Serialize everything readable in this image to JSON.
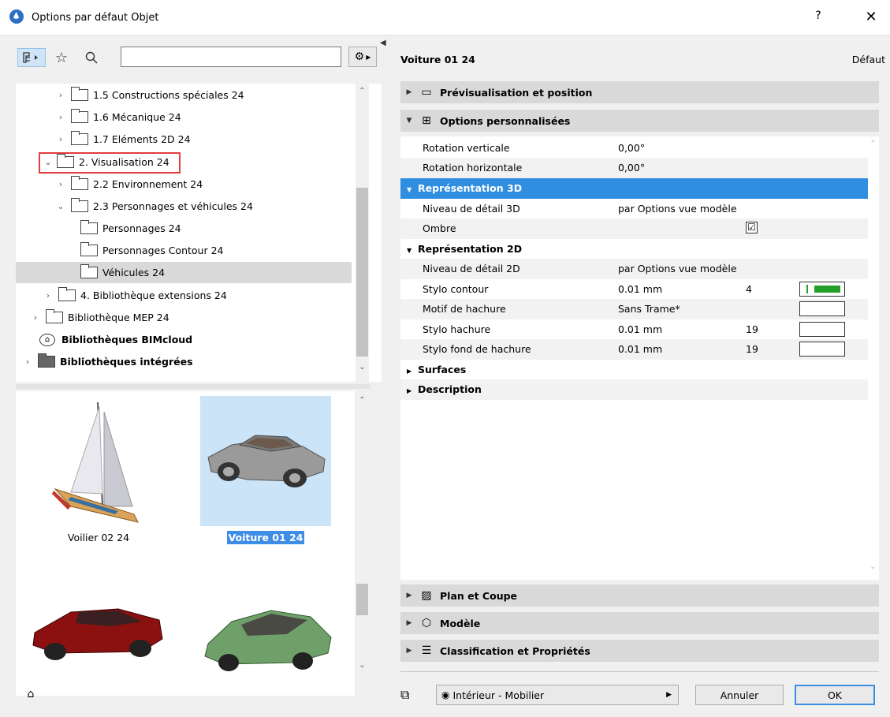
{
  "window": {
    "title": "Options par défaut Objet",
    "help": "?",
    "close": "✕"
  },
  "toolbar": {
    "search_placeholder": "",
    "search_value": ""
  },
  "tree": {
    "items": [
      {
        "label": "1.5 Constructions spéciales 24"
      },
      {
        "label": "1.6 Mécanique 24"
      },
      {
        "label": "1.7 Eléments 2D 24"
      },
      {
        "label": "2. Visualisation 24"
      },
      {
        "label": "2.2 Environnement 24"
      },
      {
        "label": "2.3 Personnages et véhicules 24"
      },
      {
        "label": "Personnages 24"
      },
      {
        "label": "Personnages Contour 24"
      },
      {
        "label": "Véhicules 24"
      },
      {
        "label": "4. Bibliothèque extensions 24"
      },
      {
        "label": "Bibliothèque MEP 24"
      },
      {
        "label": "Bibliothèques BIMcloud"
      },
      {
        "label": "Bibliothèques intégrées"
      }
    ]
  },
  "previews": [
    {
      "label": "Voilier 02 24"
    },
    {
      "label": "Voiture 01 24"
    },
    {
      "label": ""
    },
    {
      "label": ""
    }
  ],
  "object": {
    "name": "Voiture 01 24",
    "default_label": "Défaut"
  },
  "sections": {
    "preview_position": "Prévisualisation et position",
    "custom_options": "Options personnalisées",
    "plan_section": "Plan et Coupe",
    "model": "Modèle",
    "classification": "Classification et Propriétés"
  },
  "params": {
    "rot_v": {
      "name": "Rotation verticale",
      "value": "0,00°"
    },
    "rot_h": {
      "name": "Rotation horizontale",
      "value": "0,00°"
    },
    "rep3d": "Représentation 3D",
    "detail3d": {
      "name": "Niveau de détail 3D",
      "value": "par Options vue modèle"
    },
    "shadow": {
      "name": "Ombre",
      "checked": "☑"
    },
    "rep2d": "Représentation 2D",
    "detail2d": {
      "name": "Niveau de détail 2D",
      "value": "par Options vue modèle"
    },
    "pen_contour": {
      "name": "Stylo contour",
      "value": "0.01 mm",
      "num": "4",
      "color": "#22a02a"
    },
    "hatch": {
      "name": "Motif de hachure",
      "value": "Sans Trame*"
    },
    "pen_hatch": {
      "name": "Stylo hachure",
      "value": "0.01 mm",
      "num": "19"
    },
    "pen_hatch_bg": {
      "name": "Stylo fond de hachure",
      "value": "0.01 mm",
      "num": "19"
    },
    "surfaces": "Surfaces",
    "description": "Description"
  },
  "footer": {
    "layer": "Intérieur - Mobilier",
    "cancel": "Annuler",
    "ok": "OK"
  },
  "colors": {
    "selection_blue": "#2f8ee0",
    "highlight_red": "#e23d3d",
    "pen_green": "#22a02a"
  }
}
